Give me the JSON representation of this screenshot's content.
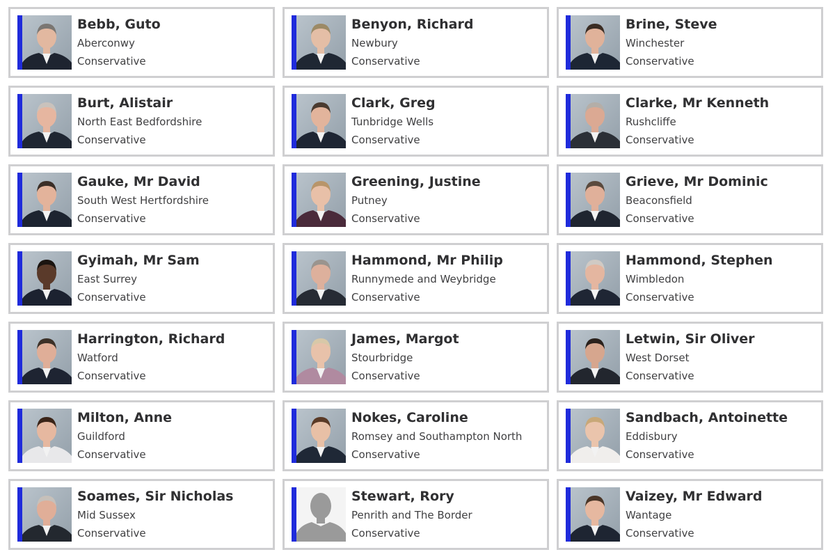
{
  "colors": {
    "party_accent": "#1f2bdb",
    "card_border": "#cfcfd1",
    "name_text": "#303032",
    "detail_text": "#404042"
  },
  "members": [
    {
      "name": "Bebb, Guto",
      "constituency": "Aberconwy",
      "party": "Conservative",
      "photo": "portrait",
      "suit": "#1e2430",
      "hair": "#7a7672",
      "skin": "#e2b8a0"
    },
    {
      "name": "Benyon, Richard",
      "constituency": "Newbury",
      "party": "Conservative",
      "photo": "portrait",
      "suit": "#1f2733",
      "hair": "#9c8a66",
      "skin": "#e4bea6"
    },
    {
      "name": "Brine, Steve",
      "constituency": "Winchester",
      "party": "Conservative",
      "photo": "portrait",
      "suit": "#1d2634",
      "hair": "#3b2d24",
      "skin": "#e0b29a"
    },
    {
      "name": "Burt, Alistair",
      "constituency": "North East Bedfordshire",
      "party": "Conservative",
      "photo": "portrait",
      "suit": "#1f2632",
      "hair": "#c9c2bc",
      "skin": "#e6b6a0"
    },
    {
      "name": "Clark, Greg",
      "constituency": "Tunbridge Wells",
      "party": "Conservative",
      "photo": "portrait",
      "suit": "#1e2533",
      "hair": "#4a3b30",
      "skin": "#e2b49c"
    },
    {
      "name": "Clarke, Mr Kenneth",
      "constituency": "Rushcliffe",
      "party": "Conservative",
      "photo": "portrait",
      "suit": "#2b2f36",
      "hair": "#b4aea8",
      "skin": "#dba993"
    },
    {
      "name": "Gauke, Mr David",
      "constituency": "South West Hertfordshire",
      "party": "Conservative",
      "photo": "portrait",
      "suit": "#1d2430",
      "hair": "#3a2e27",
      "skin": "#e3b39b"
    },
    {
      "name": "Greening, Justine",
      "constituency": "Putney",
      "party": "Conservative",
      "photo": "portrait",
      "suit": "#4a2a3a",
      "hair": "#b8956a",
      "skin": "#e8c0a8"
    },
    {
      "name": "Grieve, Mr Dominic",
      "constituency": "Beaconsfield",
      "party": "Conservative",
      "photo": "portrait",
      "suit": "#1f2530",
      "hair": "#5a4a3e",
      "skin": "#e0b09a"
    },
    {
      "name": "Gyimah, Mr Sam",
      "constituency": "East Surrey",
      "party": "Conservative",
      "photo": "portrait",
      "suit": "#1c2230",
      "hair": "#1a1410",
      "skin": "#5a3a2a"
    },
    {
      "name": "Hammond, Mr Philip",
      "constituency": "Runnymede and Weybridge",
      "party": "Conservative",
      "photo": "portrait",
      "suit": "#262b34",
      "hair": "#9a948e",
      "skin": "#ddb09c"
    },
    {
      "name": "Hammond, Stephen",
      "constituency": "Wimbledon",
      "party": "Conservative",
      "photo": "portrait",
      "suit": "#1f2634",
      "hair": "#d0cac4",
      "skin": "#e4b6a0"
    },
    {
      "name": "Harrington, Richard",
      "constituency": "Watford",
      "party": "Conservative",
      "photo": "portrait",
      "suit": "#1e2432",
      "hair": "#3c3128",
      "skin": "#dfae98"
    },
    {
      "name": "James, Margot",
      "constituency": "Stourbridge",
      "party": "Conservative",
      "photo": "portrait",
      "suit": "#b08aa0",
      "hair": "#d8c8a8",
      "skin": "#e8c2aa"
    },
    {
      "name": "Letwin, Sir Oliver",
      "constituency": "West Dorset",
      "party": "Conservative",
      "photo": "portrait",
      "suit": "#22262e",
      "hair": "#2a211c",
      "skin": "#d6a68e"
    },
    {
      "name": "Milton, Anne",
      "constituency": "Guildford",
      "party": "Conservative",
      "photo": "portrait",
      "suit": "#e8e8ea",
      "hair": "#3a2418",
      "skin": "#e6b8a0"
    },
    {
      "name": "Nokes, Caroline",
      "constituency": "Romsey and Southampton North",
      "party": "Conservative",
      "photo": "portrait",
      "suit": "#1f2836",
      "hair": "#5a3a26",
      "skin": "#e8c0a6"
    },
    {
      "name": "Sandbach, Antoinette",
      "constituency": "Eddisbury",
      "party": "Conservative",
      "photo": "portrait",
      "suit": "#f0eeec",
      "hair": "#c8a878",
      "skin": "#eac4ac"
    },
    {
      "name": "Soames, Sir Nicholas",
      "constituency": "Mid Sussex",
      "party": "Conservative",
      "photo": "portrait",
      "suit": "#23282f",
      "hair": "#c6c0ba",
      "skin": "#e0ae98"
    },
    {
      "name": "Stewart, Rory",
      "constituency": "Penrith and The Border",
      "party": "Conservative",
      "photo": "placeholder",
      "suit": "#9a9a9a",
      "hair": "#9a9a9a",
      "skin": "#9a9a9a"
    },
    {
      "name": "Vaizey, Mr Edward",
      "constituency": "Wantage",
      "party": "Conservative",
      "photo": "portrait",
      "suit": "#1e2532",
      "hair": "#4a3628",
      "skin": "#e6b8a0"
    }
  ]
}
